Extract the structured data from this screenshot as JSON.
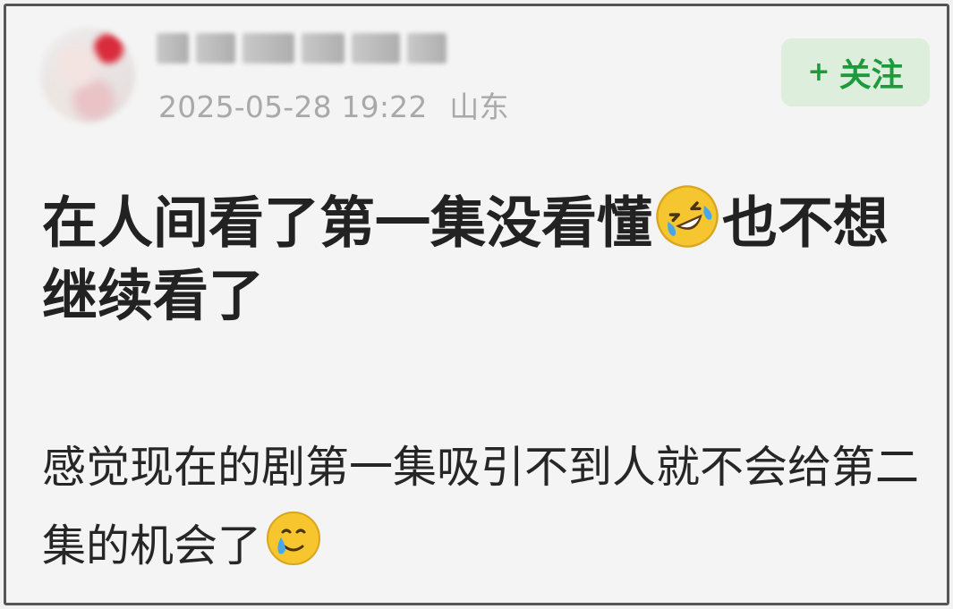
{
  "post": {
    "author": {
      "name": "",
      "avatar": "blurred-avatar"
    },
    "timestamp": "2025-05-28 19:22",
    "location": "山东",
    "follow_button": {
      "icon": "plus",
      "label": "关注",
      "color": "#1b9b3b",
      "background": "#ddeedd"
    },
    "title": {
      "part1": "在人间看了第一集没看懂",
      "emoji": "rolling-on-the-floor-laughing",
      "part2": "也不想继续看了"
    },
    "body": {
      "text": "感觉现在的剧第一集吸引不到人就不会给第二集的机会了",
      "emoji": "smiling-face-with-tear"
    }
  }
}
